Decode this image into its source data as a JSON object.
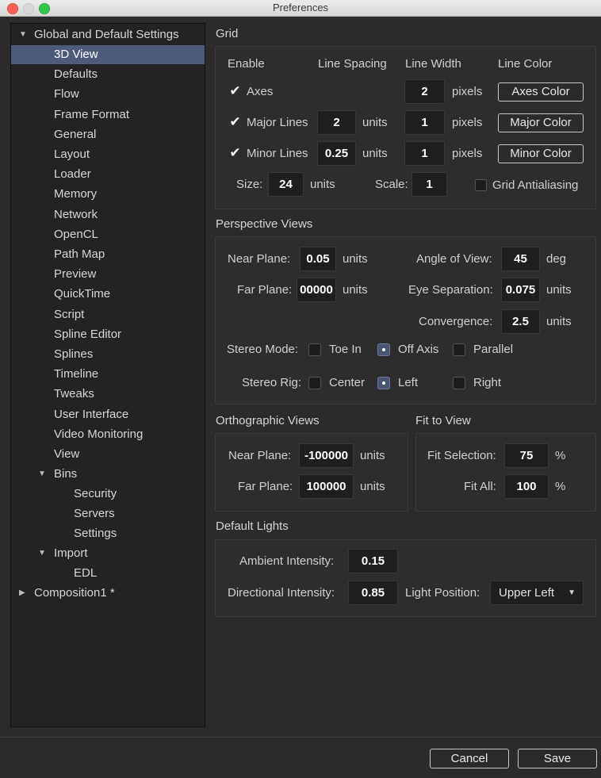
{
  "window": {
    "title": "Preferences"
  },
  "tree": {
    "global": "Global and Default Settings",
    "items": [
      "3D View",
      "Defaults",
      "Flow",
      "Frame Format",
      "General",
      "Layout",
      "Loader",
      "Memory",
      "Network",
      "OpenCL",
      "Path Map",
      "Preview",
      "QuickTime",
      "Script",
      "Spline Editor",
      "Splines",
      "Timeline",
      "Tweaks",
      "User Interface",
      "Video Monitoring",
      "View"
    ],
    "bins": "Bins",
    "bins_items": [
      "Security",
      "Servers",
      "Settings"
    ],
    "import": "Import",
    "import_items": [
      "EDL"
    ],
    "composition": "Composition1 *"
  },
  "grid": {
    "title": "Grid",
    "col_enable": "Enable",
    "col_spacing": "Line Spacing",
    "col_width": "Line Width",
    "col_color": "Line Color",
    "axes": {
      "label": "Axes",
      "checked": true,
      "width": "2",
      "unit": "pixels",
      "color_btn": "Axes Color"
    },
    "major": {
      "label": "Major Lines",
      "checked": true,
      "spacing": "2",
      "spacing_unit": "units",
      "width": "1",
      "unit": "pixels",
      "color_btn": "Major Color"
    },
    "minor": {
      "label": "Minor Lines",
      "checked": true,
      "spacing": "0.25",
      "spacing_unit": "units",
      "width": "1",
      "unit": "pixels",
      "color_btn": "Minor Color"
    },
    "size_label": "Size:",
    "size": "24",
    "size_unit": "units",
    "scale_label": "Scale:",
    "scale": "1",
    "antialias": "Grid Antialiasing"
  },
  "perspective": {
    "title": "Perspective Views",
    "near_label": "Near Plane:",
    "near": "0.05",
    "near_unit": "units",
    "far_label": "Far Plane:",
    "far": "00000",
    "far_unit": "units",
    "angle_label": "Angle of View:",
    "angle": "45",
    "angle_unit": "deg",
    "eye_label": "Eye Separation:",
    "eye": "0.075",
    "eye_unit": "units",
    "conv_label": "Convergence:",
    "conv": "2.5",
    "conv_unit": "units",
    "stereo_mode_label": "Stereo Mode:",
    "stereo_modes": [
      "Toe In",
      "Off Axis",
      "Parallel"
    ],
    "stereo_rig_label": "Stereo Rig:",
    "stereo_rigs": [
      "Center",
      "Left",
      "Right"
    ]
  },
  "ortho": {
    "title": "Orthographic Views",
    "near_label": "Near Plane:",
    "near": "-100000",
    "near_unit": "units",
    "far_label": "Far Plane:",
    "far": "100000",
    "far_unit": "units"
  },
  "fit": {
    "title": "Fit to View",
    "sel_label": "Fit Selection:",
    "sel": "75",
    "sel_unit": "%",
    "all_label": "Fit All:",
    "all": "100",
    "all_unit": "%"
  },
  "lights": {
    "title": "Default Lights",
    "ambient_label": "Ambient Intensity:",
    "ambient": "0.15",
    "dir_label": "Directional Intensity:",
    "dir": "0.85",
    "pos_label": "Light Position:",
    "pos": "Upper Left"
  },
  "footer": {
    "cancel": "Cancel",
    "save": "Save"
  }
}
